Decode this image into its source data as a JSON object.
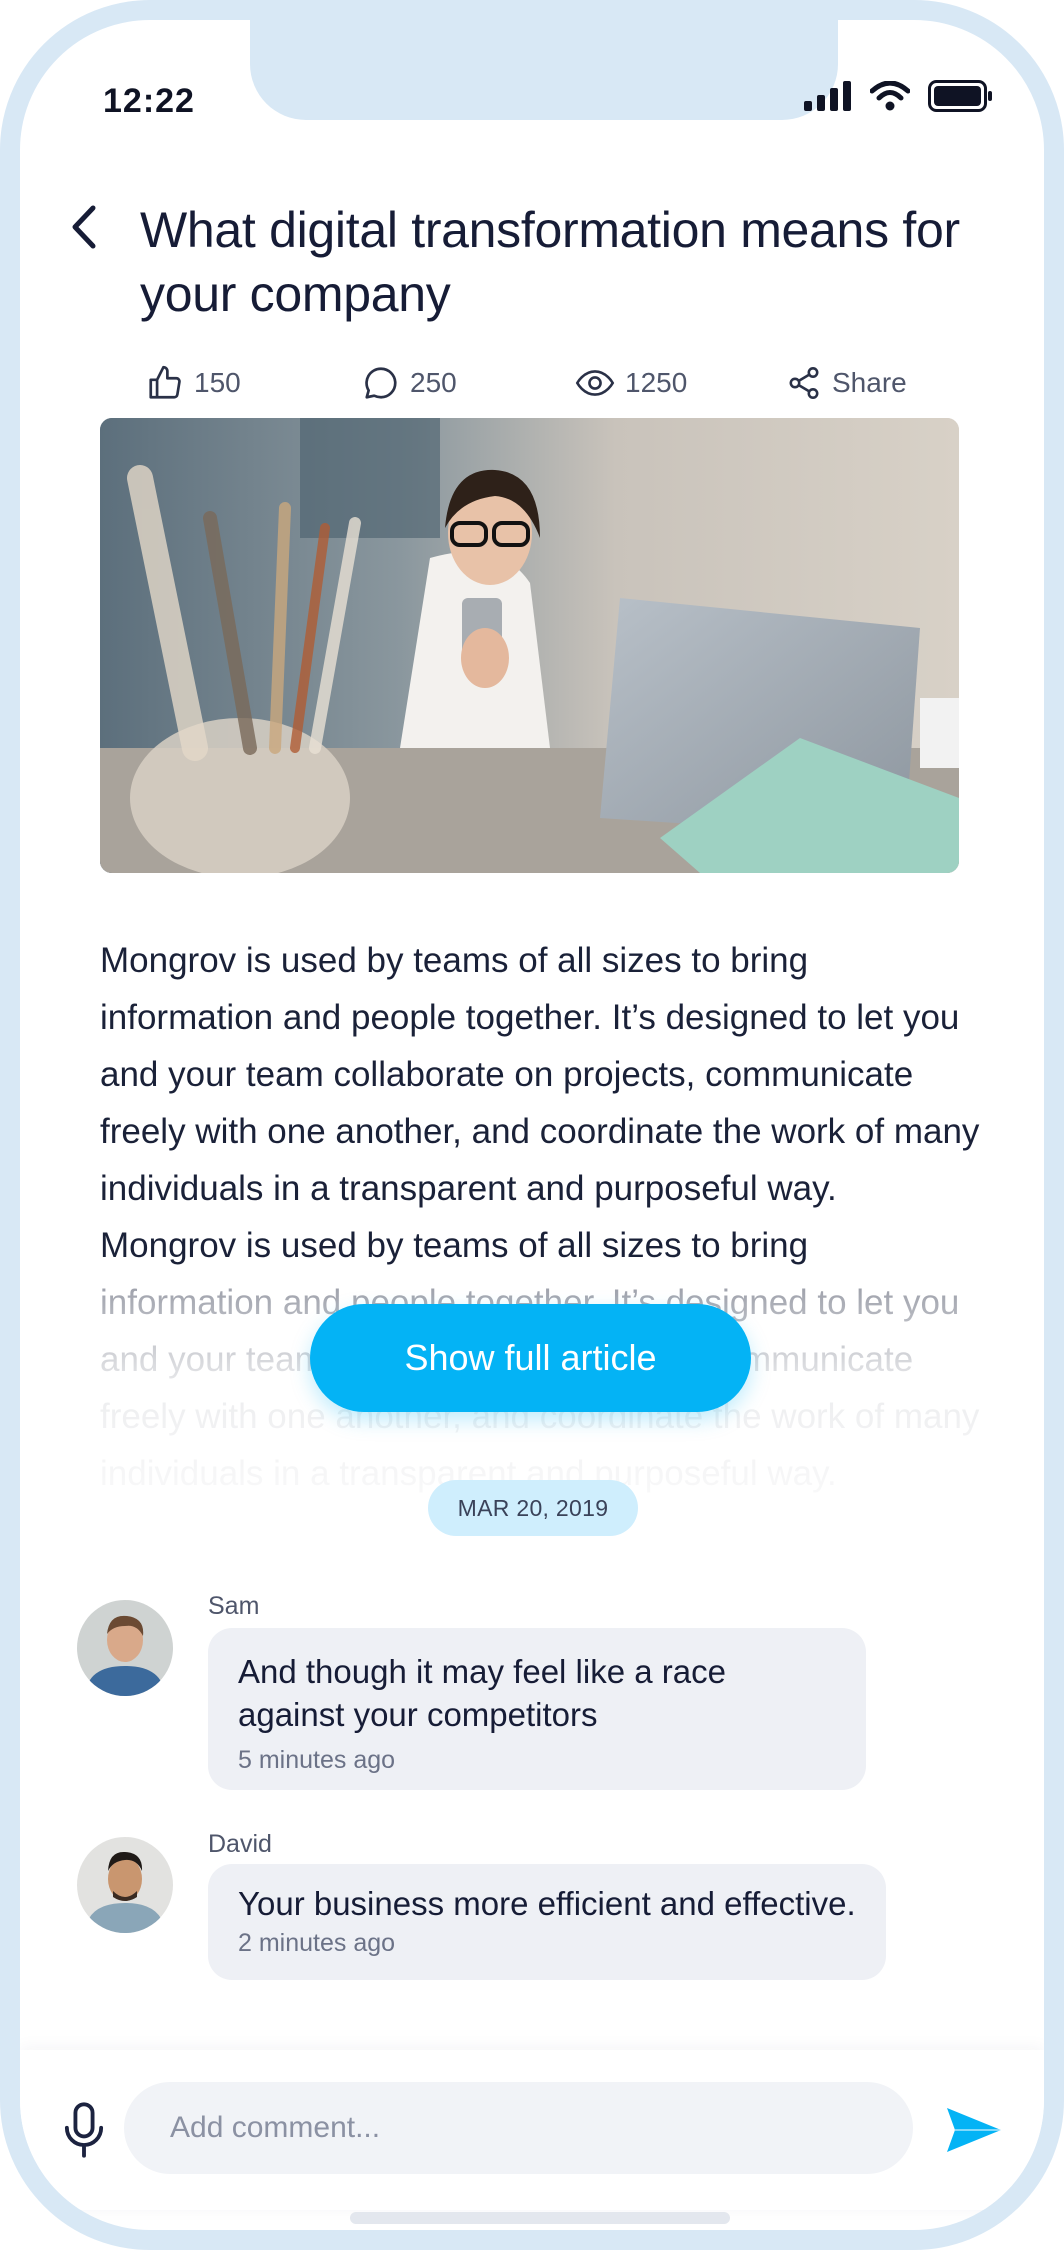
{
  "status": {
    "time": "12:22"
  },
  "article": {
    "title": "What digital transformation means for your company",
    "stats": {
      "likes": "150",
      "comments": "250",
      "views": "1250",
      "share_label": "Share"
    },
    "body_visible": "Mongrov is used by teams of all sizes to bring information and people together. It’s designed to let you and your team collaborate on projects, communicate freely with one another, and coordinate the work of many individuals in a transparent and purposeful way. Mongrov is used by teams of all sizes",
    "body_faded": "to bring information and people together. It’s designed to let you and your team collaborate on projects, communicate freely with one another, and coordinate the work of many individuals in a transparent and purposeful way.",
    "show_full_label": "Show full article",
    "date": "MAR 20, 2019"
  },
  "comments": [
    {
      "author": "Sam",
      "text": "And though it may feel like a race against your competitors",
      "time": "5 minutes ago"
    },
    {
      "author": "David",
      "text": "Your business more efficient and effective.",
      "time": "2 minutes ago"
    }
  ],
  "composer": {
    "placeholder": "Add comment..."
  },
  "colors": {
    "accent": "#04b3f5",
    "device_frame": "#d8e8f5",
    "bubble": "#eef0f5",
    "date_badge": "#cfeefd"
  }
}
